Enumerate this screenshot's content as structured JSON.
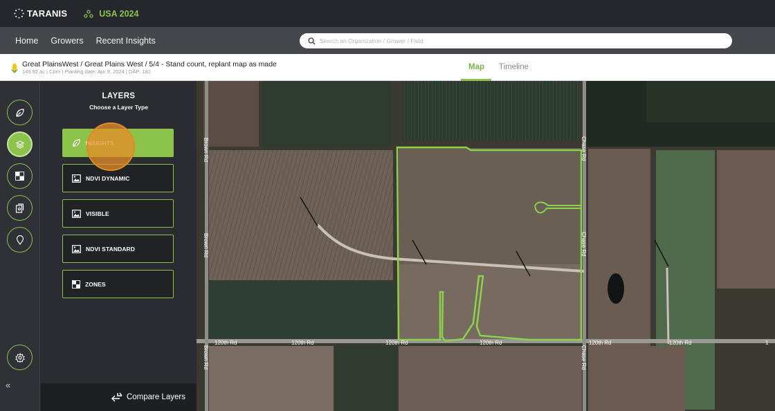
{
  "brand": {
    "logo_text": "TARANIS",
    "org_name": "USA 2024"
  },
  "nav": {
    "items": [
      "Home",
      "Growers",
      "Recent Insights"
    ]
  },
  "search": {
    "placeholder": "Search an Organization / Grower / Field"
  },
  "breadcrumb": {
    "title": "Great PlainsWest / Great Plains West / 5/4 - Stand count, replant map as made",
    "subtitle": "149.92 ac | Corn | Planting date: Apr 9, 2024 | DAP: 182"
  },
  "tabs": {
    "map": "Map",
    "timeline": "Timeline",
    "active": "Map"
  },
  "layers_panel": {
    "title": "LAYERS",
    "subtitle": "Choose a Layer Type",
    "items": [
      {
        "label": "INSIGHTS",
        "icon": "leaf-icon",
        "active": true
      },
      {
        "label": "NDVI DYNAMIC",
        "icon": "image-icon",
        "active": false
      },
      {
        "label": "VISIBLE",
        "icon": "image-icon",
        "active": false
      },
      {
        "label": "NDVI STANDARD",
        "icon": "image-icon",
        "active": false
      },
      {
        "label": "ZONES",
        "icon": "zones-icon",
        "active": false
      }
    ],
    "compare_label": "Compare Layers"
  },
  "rail": {
    "items": [
      "leaf-icon",
      "layers-icon",
      "zones-icon",
      "report-icon",
      "location-icon"
    ],
    "active": "layers-icon",
    "settings_icon": "gear-icon",
    "collapse_label": "«"
  },
  "map": {
    "road_labels": {
      "horizontal": "120th Rd",
      "brown": "Brown Rd",
      "chase": "Chase Rd",
      "edge": "1"
    }
  },
  "colors": {
    "accent": "#8cc34a",
    "topbar": "#25272c",
    "navbar": "#45474c",
    "panel": "#2a2c31",
    "field_outline": "#8cd24a"
  }
}
